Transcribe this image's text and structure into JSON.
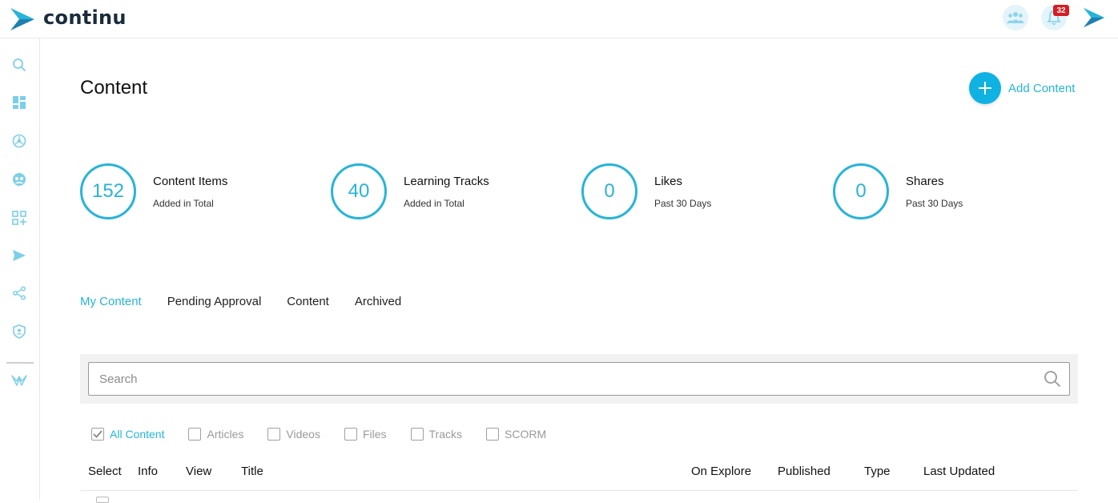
{
  "app": {
    "name": "continu"
  },
  "topbar": {
    "notification_count": "32"
  },
  "page": {
    "title": "Content"
  },
  "actions": {
    "add_content_label": "Add Content"
  },
  "stats": [
    {
      "value": "152",
      "title": "Content Items",
      "subtitle": "Added in Total"
    },
    {
      "value": "40",
      "title": "Learning Tracks",
      "subtitle": "Added in Total"
    },
    {
      "value": "0",
      "title": "Likes",
      "subtitle": "Past 30 Days"
    },
    {
      "value": "0",
      "title": "Shares",
      "subtitle": "Past 30 Days"
    }
  ],
  "tabs": [
    {
      "label": "My Content",
      "active": true
    },
    {
      "label": "Pending Approval",
      "active": false
    },
    {
      "label": "Content",
      "active": false
    },
    {
      "label": "Archived",
      "active": false
    }
  ],
  "search": {
    "placeholder": "Search",
    "value": ""
  },
  "filters": [
    {
      "label": "All Content",
      "checked": true
    },
    {
      "label": "Articles",
      "checked": false
    },
    {
      "label": "Videos",
      "checked": false
    },
    {
      "label": "Files",
      "checked": false
    },
    {
      "label": "Tracks",
      "checked": false
    },
    {
      "label": "SCORM",
      "checked": false
    }
  ],
  "table": {
    "columns": [
      "Select",
      "Info",
      "View",
      "Title",
      "On Explore",
      "Published",
      "Type",
      "Last Updated"
    ]
  },
  "sidebar": {
    "icons": [
      "search-icon",
      "dashboard-icon",
      "explore-icon",
      "users-icon",
      "add-widgets-icon",
      "send-icon",
      "share-icon",
      "admin-shield-icon",
      "brand-icon"
    ]
  },
  "colors": {
    "accent": "#27b4d9",
    "badge": "#d61d22",
    "add_button": "#0fb2e2"
  }
}
